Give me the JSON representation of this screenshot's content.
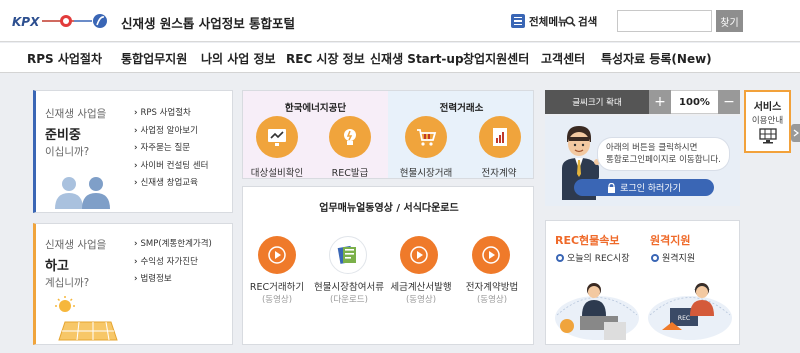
{
  "header": {
    "brand": "KPX",
    "title": "신재생 원스톱 사업정보 통합포털",
    "menu_label": "전체메뉴",
    "search_label": "검색",
    "search_value": "",
    "search_button": "찾기"
  },
  "nav": [
    "RPS 사업절차",
    "통합업무지원",
    "나의 사업 정보",
    "REC 시장 정보",
    "신재생 Start-up",
    "창업지원센터",
    "고객센터",
    "특성자료 등록(New)"
  ],
  "prep_card": {
    "line1": "신재생 사업을",
    "big": "준비중",
    "line3": "이십니까?",
    "links": [
      "RPS 사업절차",
      "사업정 알아보기",
      "자주묻는 질문",
      "사이버 컨설팅 센터",
      "신재생 창업교육"
    ]
  },
  "doing_card": {
    "line1": "신재생 사업을",
    "big": "하고",
    "line3": "계십니까?",
    "links": [
      "SMP(계통한계가격)",
      "수익성 자가진단",
      "법령정보"
    ]
  },
  "energy_corp": {
    "title": "한국에너지공단",
    "items": [
      "대상설비확인",
      "REC발급"
    ]
  },
  "power_exchange": {
    "title": "전력거래소",
    "items": [
      "현물시장거래",
      "전자계약"
    ]
  },
  "manuals": {
    "title": "업무매뉴얼동영상 / 서식다운로드",
    "items": [
      {
        "label": "REC거래하기",
        "sub": "(동영상)"
      },
      {
        "label": "현물시장참여서류",
        "sub": "(다운로드)"
      },
      {
        "label": "세금계산서발행",
        "sub": "(동영상)"
      },
      {
        "label": "전자계약방법",
        "sub": "(동영상)"
      }
    ]
  },
  "font_bar": {
    "label": "글씨크기 확대",
    "plus": "+",
    "zoom": "100%",
    "minus": "−"
  },
  "service_guide": {
    "line1": "서비스",
    "line2": "이용안내"
  },
  "login_card": {
    "bubble_line1": "아래의 버튼을 클릭하시면",
    "bubble_line2": "통합로그인페이지로 이동합니다.",
    "button": "로그인 하러가기"
  },
  "rec_card": {
    "title1": "REC현물속보",
    "item1": "오늘의 REC시장",
    "title2": "원격지원",
    "item2": "원격지원",
    "monitor_text": "REC"
  },
  "colors": {
    "orange": "#ef7a2a",
    "blue": "#3a66b5",
    "pink_panel": "#f7eef8",
    "blue_panel": "#e8f1fa"
  }
}
